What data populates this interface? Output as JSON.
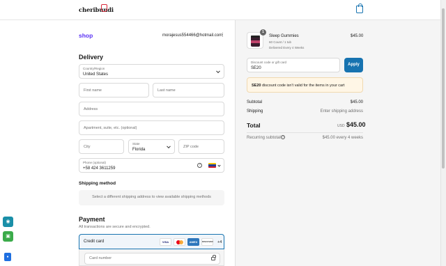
{
  "header": {
    "logo_text": "cheribundi"
  },
  "account": {
    "shop_label": "shop",
    "email": "morajesus554466@hotmail.com",
    "menu_glyph": "⋮"
  },
  "delivery": {
    "title": "Delivery",
    "country_label": "Country/Region",
    "country_value": "United States",
    "first_name_placeholder": "First name",
    "last_name_placeholder": "Last name",
    "address_placeholder": "Address",
    "apartment_placeholder": "Apartment, suite, etc. (optional)",
    "city_placeholder": "City",
    "state_label": "State",
    "state_value": "Florida",
    "zip_placeholder": "ZIP code",
    "phone_label": "Phone (optional)",
    "phone_value": "+58 424 3611259",
    "help_glyph": "?"
  },
  "shipping": {
    "title": "Shipping method",
    "message": "Select a different shipping address to view available shipping methods"
  },
  "payment": {
    "title": "Payment",
    "subtitle": "All transactions are secure and encrypted.",
    "credit_card_label": "Credit card",
    "card_brands": [
      "VISA",
      "MC",
      "AMEX",
      "DISCOVER"
    ],
    "more_brands": "+4",
    "card_number_placeholder": "Card number"
  },
  "order": {
    "quantity": "1",
    "product_name": "Sleep Gummies",
    "variant": "60 Count / 1 tub",
    "plan": "Delivered Every 4 Weeks",
    "price": "$45.00",
    "discount_label": "Discount code or gift card",
    "discount_value": "SE20",
    "apply_label": "Apply",
    "notice_code": "SE20",
    "notice_text": " discount code isn't valid for the items in your cart",
    "subtotal_label": "Subtotal",
    "subtotal_value": "$45.00",
    "shipping_label": "Shipping",
    "shipping_value": "Enter shipping address",
    "total_label": "Total",
    "total_currency": "USD",
    "total_value": "$45.00",
    "recurring_label": "Recurring subtotal",
    "recurring_value": "$45.00 every 4 weeks",
    "info_glyph": "?"
  },
  "colors": {
    "accent": "#1773b0",
    "shop_purple": "#5a31f4",
    "warning_bg": "#fff6e6",
    "widget_teal": "#1a8fa8",
    "widget_green": "#3bab4a",
    "widget_blue": "#1f6fe0"
  }
}
